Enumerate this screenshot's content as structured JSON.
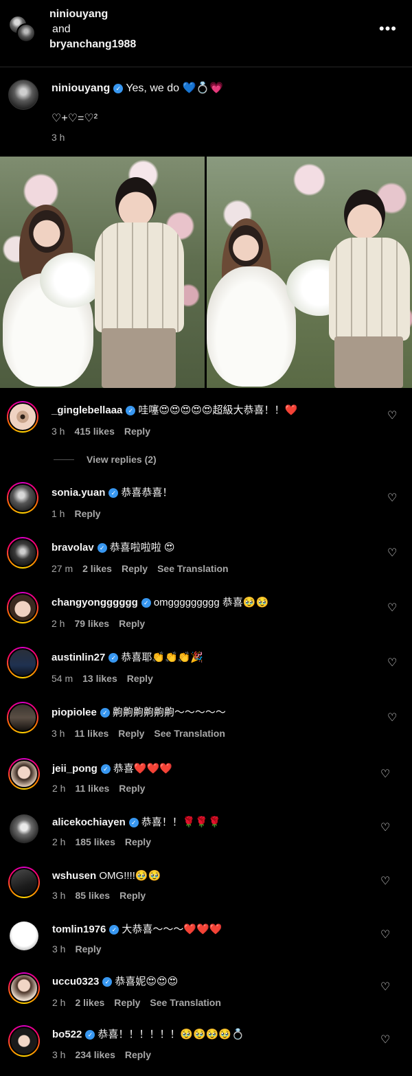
{
  "header": {
    "user1": "niniouyang",
    "joiner": "and",
    "user2": "bryanchang1988",
    "more_label": "•••"
  },
  "caption": {
    "username": "niniouyang",
    "text": "Yes, we do 💙💍💗",
    "text2": "♡+♡=♡²",
    "time": "3 h"
  },
  "view_replies": "View replies (2)",
  "comments": [
    {
      "user": "_ginglebellaaa",
      "text": "哇噻😍😍😍😍😍超級大恭喜！！❤️",
      "time": "3 h",
      "likes": "415 likes",
      "reply": "Reply",
      "translate": ""
    },
    {
      "user": "sonia.yuan",
      "text": "恭喜恭喜！",
      "time": "1 h",
      "likes": "",
      "reply": "Reply",
      "translate": ""
    },
    {
      "user": "bravolav",
      "text": "恭喜啦啦啦 😍",
      "time": "27 m",
      "likes": "2 likes",
      "reply": "Reply",
      "translate": "See Translation"
    },
    {
      "user": "changyongggggg",
      "text": "omggggggggg 恭喜🥹🥹",
      "time": "2 h",
      "likes": "79 likes",
      "reply": "Reply",
      "translate": ""
    },
    {
      "user": "austinlin27",
      "text": "恭喜耶👏👏👏🎉",
      "time": "54 m",
      "likes": "13 likes",
      "reply": "Reply",
      "translate": ""
    },
    {
      "user": "piopiolee",
      "text": "齁齁齁齁齁齁～～～～～",
      "time": "3 h",
      "likes": "11 likes",
      "reply": "Reply",
      "translate": "See Translation"
    },
    {
      "user": "jeii_pong",
      "text": "恭喜❤️❤️❤️",
      "time": "2 h",
      "likes": "11 likes",
      "reply": "Reply",
      "translate": ""
    },
    {
      "user": "alicekochiayen",
      "text": "恭喜！！🌹🌹🌹",
      "time": "2 h",
      "likes": "185 likes",
      "reply": "Reply",
      "translate": ""
    },
    {
      "user": "wshusen",
      "text": "OMG!!!!🥹🥹",
      "time": "3 h",
      "likes": "85 likes",
      "reply": "Reply",
      "translate": ""
    },
    {
      "user": "tomlin1976",
      "text": "大恭喜～～～❤️❤️❤️",
      "time": "3 h",
      "likes": "",
      "reply": "Reply",
      "translate": ""
    },
    {
      "user": "uccu0323",
      "text": "恭喜妮😍😍😍",
      "time": "2 h",
      "likes": "2 likes",
      "reply": "Reply",
      "translate": "See Translation"
    },
    {
      "user": "bo522",
      "text": "恭喜！！！！！！🥹🥹🥹🥹💍",
      "time": "3 h",
      "likes": "234 likes",
      "reply": "Reply",
      "translate": ""
    }
  ],
  "icons": {
    "verified": "verified-badge-icon",
    "heart": "heart-outline-icon",
    "more": "more-dots-icon"
  },
  "colors": {
    "background": "#000000",
    "text": "#f5f5f5",
    "secondary": "#a8a8a8",
    "verified": "#3897f0",
    "story_ring": "#ff0069"
  }
}
